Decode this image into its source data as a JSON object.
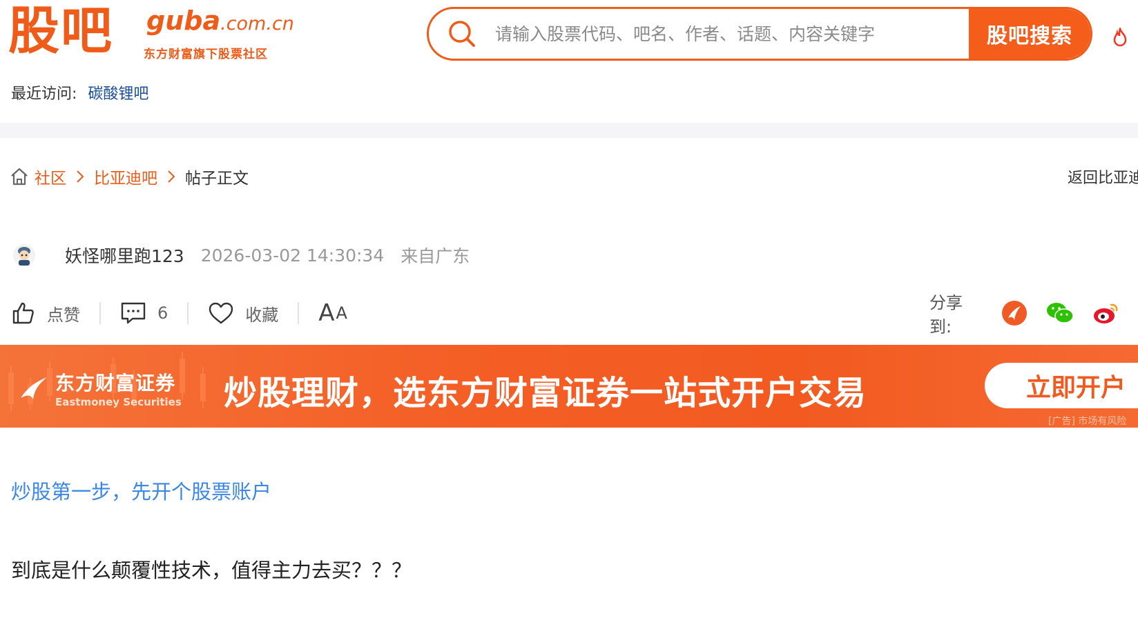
{
  "header": {
    "logo_cn": "股吧",
    "logo_en_brand": "guba",
    "logo_en_domain": ".com.cn",
    "logo_sub": "东方财富旗下股票社区",
    "search_placeholder": "请输入股票代码、吧名、作者、话题、内容关键字",
    "search_button": "股吧搜索",
    "recent_label": "最近访问:",
    "recent_link": "碳酸锂吧"
  },
  "breadcrumb": {
    "items": [
      "社区",
      "比亚迪吧"
    ],
    "current": "帖子正文",
    "back": "返回比亚迪"
  },
  "post": {
    "author": "妖怪哪里跑123",
    "time": "2026-03-02 14:30:34",
    "location": "来自广东",
    "promo_link": "炒股第一步，先开个股票账户",
    "content": "到底是什么颠覆性技术，值得主力去买？？？"
  },
  "actions": {
    "like": "点赞",
    "comment_count": "6",
    "favorite": "收藏",
    "font_big": "A",
    "font_small": "A",
    "share_label": "分享到:"
  },
  "banner": {
    "brand": "东方财富证券",
    "brand_en": "Eastmoney Securities",
    "slogan": "炒股理财，选东方财富证券一站式开户交易",
    "cta": "立即开户",
    "risk": "[广告] 市场有风险"
  },
  "colors": {
    "brand_orange": "#ef5b18",
    "link_blue": "#1a4f9c",
    "promo_blue": "#3b87e8"
  }
}
